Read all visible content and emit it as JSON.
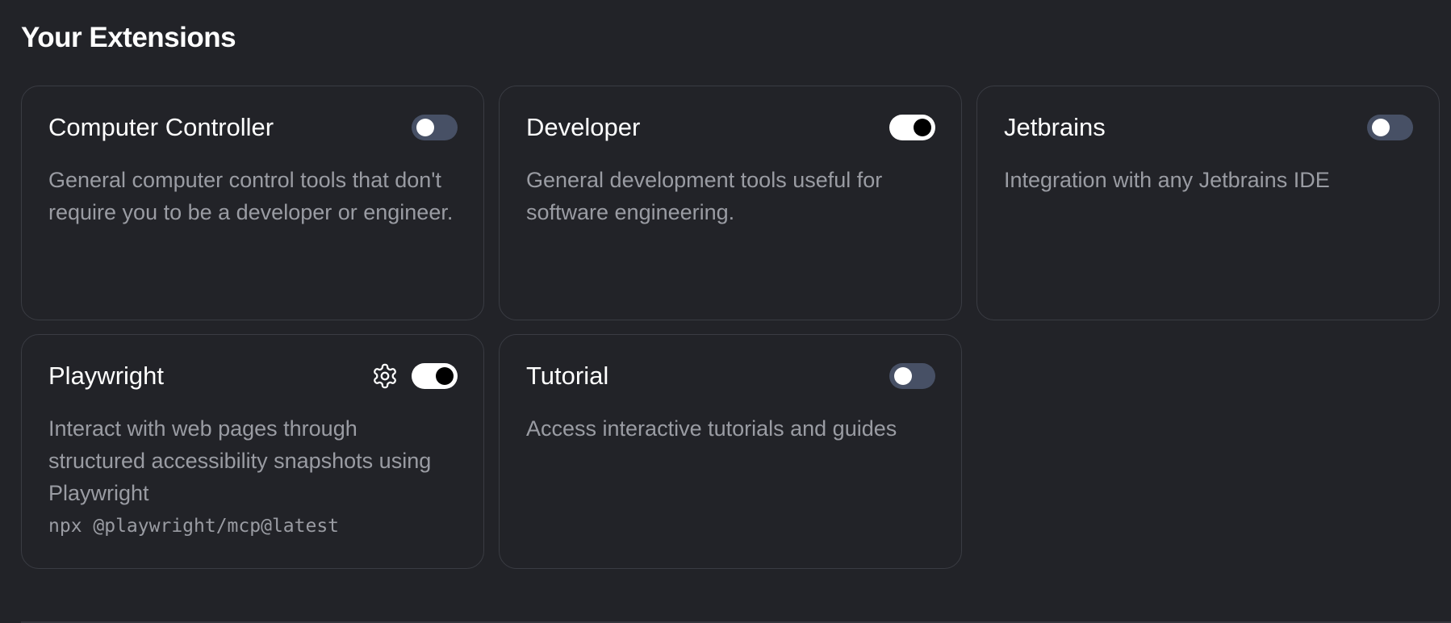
{
  "section": {
    "title": "Your Extensions"
  },
  "extensions": [
    {
      "name": "Computer Controller",
      "description": "General computer control tools that don't require you to be a developer or engineer.",
      "enabled": false
    },
    {
      "name": "Developer",
      "description": "General development tools useful for software engineering.",
      "enabled": true
    },
    {
      "name": "Jetbrains",
      "description": "Integration with any Jetbrains IDE",
      "enabled": false
    },
    {
      "name": "Playwright",
      "description": "Interact with web pages through structured accessibility snapshots using Playwright",
      "command": "npx @playwright/mcp@latest",
      "enabled": true,
      "settings_icon": "gear-icon"
    },
    {
      "name": "Tutorial",
      "description": "Access interactive tutorials and guides",
      "enabled": false
    }
  ],
  "colors": {
    "background": "#222328",
    "card_border": "#3a3c43",
    "toggle_off_track": "#475065",
    "toggle_on_track": "#ffffff",
    "text_primary": "#ffffff",
    "text_secondary": "#9a9ca3"
  }
}
